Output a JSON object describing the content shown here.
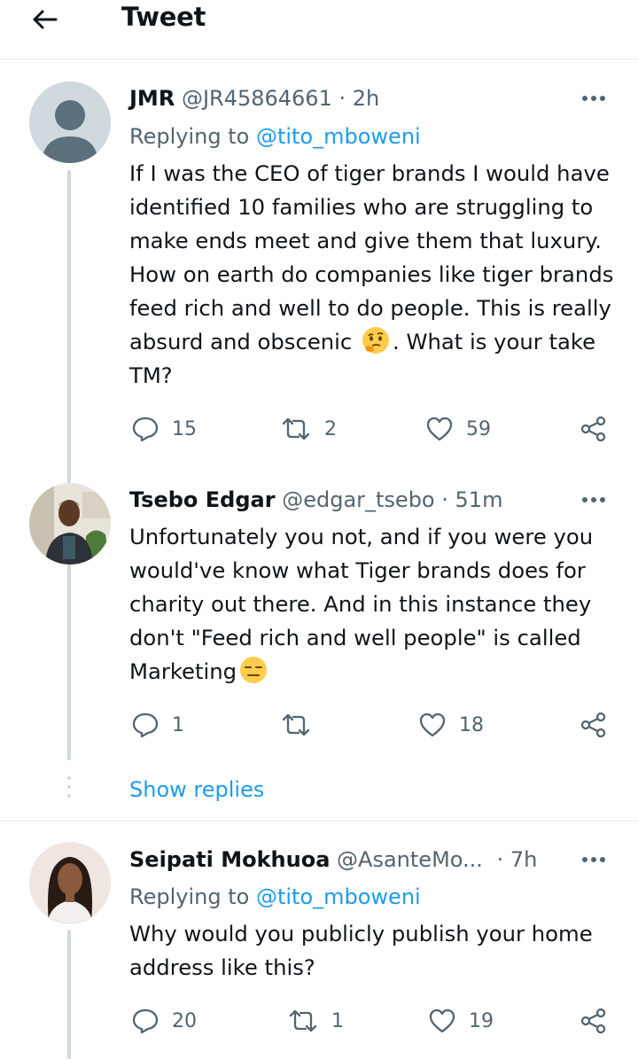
{
  "header": {
    "title": "Tweet",
    "back_icon": "arrow-left-icon"
  },
  "colors": {
    "accent": "#1d9bf0",
    "muted": "#536471",
    "text": "#0f1419",
    "line": "#cfd9de"
  },
  "tweets": [
    {
      "name": "JMR",
      "handle": "@JR45864661",
      "separator": "·",
      "time": "2h",
      "replying_label": "Replying to",
      "replying_to": "@tito_mboweni",
      "text_before_emoji": "If I was the CEO of tiger brands I would have identified 10 families who are struggling to make ends meet and give them that luxury. How on earth do companies like tiger brands feed rich and well to do people. This is really absurd and obscenic ",
      "emoji": "thinking-face-emoji",
      "text_after_emoji": ". What is your take TM?",
      "replies": "15",
      "retweets": "2",
      "likes": "59"
    },
    {
      "name": "Tsebo Edgar",
      "handle": "@edgar_tsebo",
      "separator": "·",
      "time": "51m",
      "text_before_emoji": "Unfortunately you not, and if you were you would've know what Tiger brands does for charity out there. And in this instance they don't \"Feed rich and well people\" is called Marketing",
      "emoji": "expressionless-face-emoji",
      "replies": "1",
      "retweets": "",
      "likes": "18"
    },
    {
      "name": "Seipati Mokhuoa",
      "handle": "@AsanteMo...",
      "separator": "·",
      "time": "7h",
      "replying_label": "Replying to",
      "replying_to": "@tito_mboweni",
      "text_before_emoji": "Why would you publicly publish your home address like this?",
      "replies": "20",
      "retweets": "1",
      "likes": "19"
    }
  ],
  "show_replies": "Show replies"
}
